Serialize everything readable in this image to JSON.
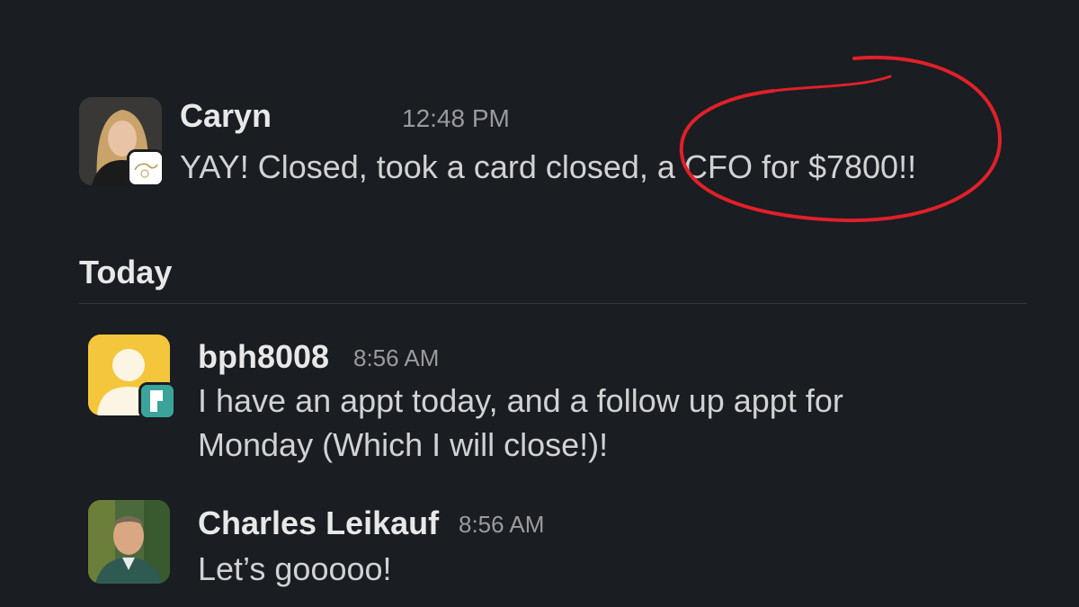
{
  "messages": [
    {
      "author": "Caryn",
      "time": "12:48 PM",
      "text": "YAY! Closed, took a card closed, a CFO for $7800!!"
    },
    {
      "author": "bph8008",
      "time": "8:56 AM",
      "lines": [
        "I have an appt today, and a follow up appt for",
        "Monday (Which I will close!)!"
      ]
    },
    {
      "author": "Charles Leikauf",
      "time": "8:56 AM",
      "text": "Let’s gooooo!"
    }
  ],
  "divider": {
    "label": "Today"
  },
  "colors": {
    "background": "#1a1d21",
    "annotation": "#e0202a",
    "default_avatar": "#f4c63b",
    "app_badge": "#3aa39a"
  },
  "icons": {
    "caryn_badge": "workspace-logo-icon",
    "bph_badge": "app-badge-icon",
    "default_avatar": "default-user-avatar-icon"
  }
}
